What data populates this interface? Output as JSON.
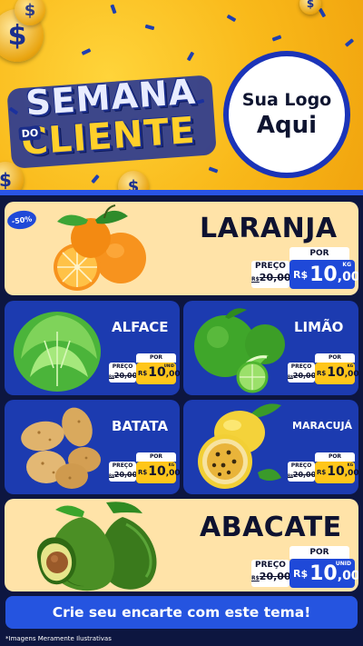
{
  "header": {
    "title_line1": "SEMANA",
    "title_do": "DO",
    "title_line2": "CLIENTE",
    "logo_line1": "Sua Logo",
    "logo_line2": "Aqui",
    "coin_symbol": "$"
  },
  "colors": {
    "header_yellow": "#f9b91a",
    "brand_blue": "#1c3bb0",
    "accent_blue": "#2554e0",
    "cream": "#ffe3a8",
    "price_yellow": "#ffc61a"
  },
  "products": [
    {
      "name": "LARANJA",
      "discount": "-50%",
      "por": "POR",
      "preco_label": "PREÇO",
      "old_currency": "R$",
      "old_price": "20,00",
      "currency": "R$",
      "price_int": "10",
      "price_dec": ",00",
      "unit": "KG",
      "icon": "orange-icon"
    },
    {
      "name": "ALFACE",
      "por": "POR",
      "preco_label": "PREÇO",
      "old_currency": "R$",
      "old_price": "20,00",
      "currency": "R$",
      "price_int": "10",
      "price_dec": ",00",
      "unit": "UNID",
      "icon": "lettuce-icon"
    },
    {
      "name": "LIMÃO",
      "por": "POR",
      "preco_label": "PREÇO",
      "old_currency": "R$",
      "old_price": "20,00",
      "currency": "R$",
      "price_int": "10",
      "price_dec": ",00",
      "unit": "KG",
      "icon": "lime-icon"
    },
    {
      "name": "BATATA",
      "por": "POR",
      "preco_label": "PREÇO",
      "old_currency": "R$",
      "old_price": "20,00",
      "currency": "R$",
      "price_int": "10",
      "price_dec": ",00",
      "unit": "KG",
      "icon": "potato-icon"
    },
    {
      "name": "MARACUJÁ",
      "por": "POR",
      "preco_label": "PREÇO",
      "old_currency": "R$",
      "old_price": "20,00",
      "currency": "R$",
      "price_int": "10",
      "price_dec": ",00",
      "unit": "KG",
      "icon": "passion-fruit-icon"
    },
    {
      "name": "ABACATE",
      "por": "POR",
      "preco_label": "PREÇO",
      "old_currency": "R$",
      "old_price": "20,00",
      "currency": "R$",
      "price_int": "10",
      "price_dec": ",00",
      "unit": "UNID",
      "icon": "avocado-icon"
    }
  ],
  "cta": "Crie seu encarte com este tema!",
  "footnote": "*Imagens Meramente Ilustrativas"
}
